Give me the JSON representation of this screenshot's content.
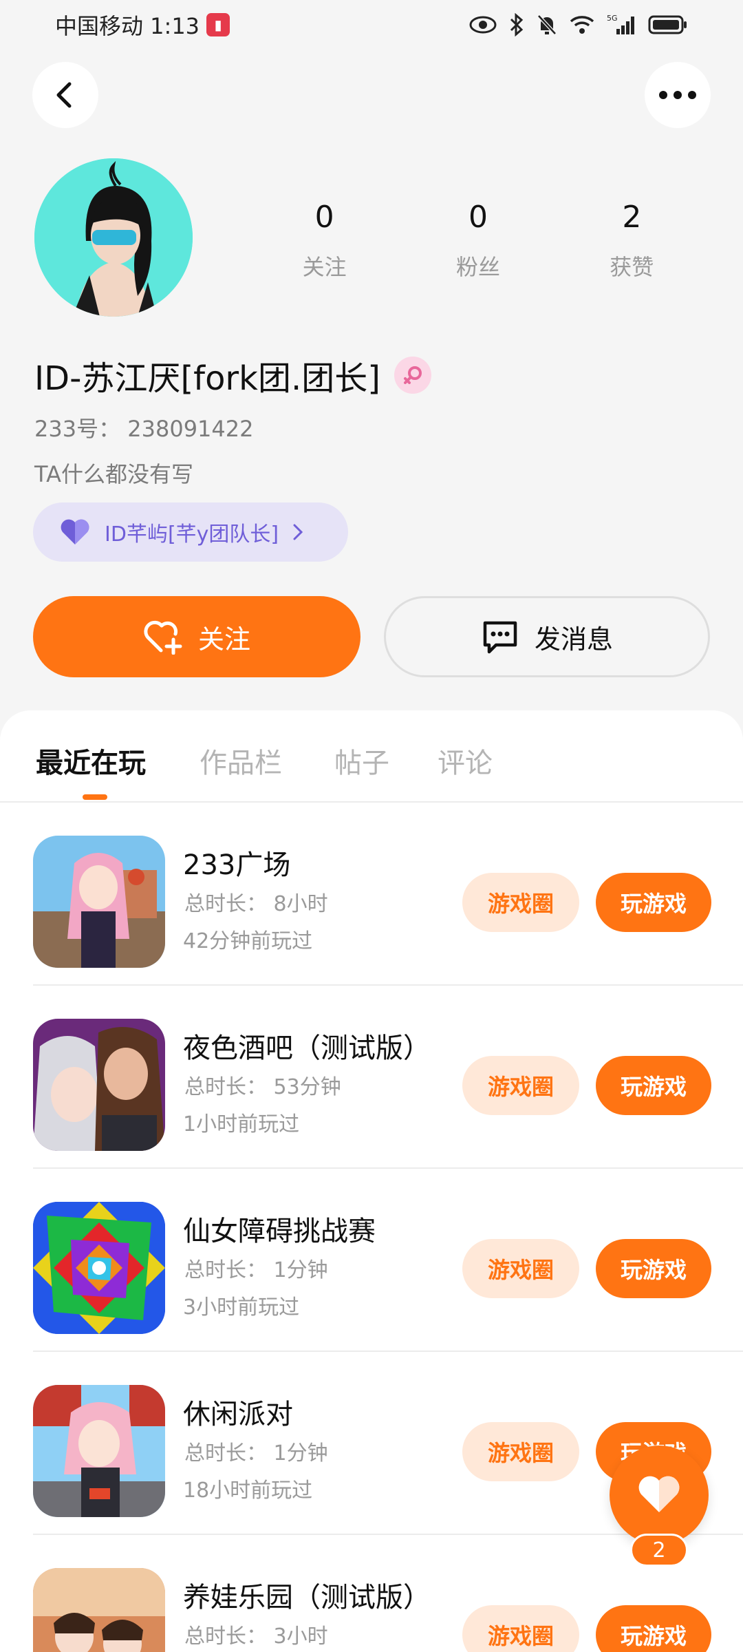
{
  "status_bar": {
    "carrier_time": "中国移动 1:13"
  },
  "profile": {
    "stats": [
      {
        "value": "0",
        "label": "关注"
      },
      {
        "value": "0",
        "label": "粉丝"
      },
      {
        "value": "2",
        "label": "获赞"
      }
    ],
    "name": "ID-苏江厌[fork团.团长]",
    "id_line": "233号： 238091422",
    "bio": "TA什么都没有写",
    "team_chip": "ID芊屿[芊y团队长]"
  },
  "actions": {
    "follow": "关注",
    "message": "发消息"
  },
  "tabs": [
    "最近在玩",
    "作品栏",
    "帖子",
    "评论"
  ],
  "games": [
    {
      "title": "233广场",
      "duration": "总时长： 8小时",
      "last_played": "42分钟前玩过",
      "circle": "游戏圈",
      "play": "玩游戏"
    },
    {
      "title": "夜色酒吧（测试版）",
      "duration": "总时长： 53分钟",
      "last_played": "1小时前玩过",
      "circle": "游戏圈",
      "play": "玩游戏"
    },
    {
      "title": "仙女障碍挑战赛",
      "duration": "总时长： 1分钟",
      "last_played": "3小时前玩过",
      "circle": "游戏圈",
      "play": "玩游戏"
    },
    {
      "title": "休闲派对",
      "duration": "总时长： 1分钟",
      "last_played": "18小时前玩过",
      "circle": "游戏圈",
      "play": "玩游戏"
    },
    {
      "title": "养娃乐园（测试版）",
      "duration": "总时长： 3小时",
      "last_played": "",
      "circle": "游戏圈",
      "play": "玩游戏"
    }
  ],
  "floating_like": {
    "count": "2"
  },
  "icons": {
    "back": "back-arrow-icon",
    "more": "more-dots-icon",
    "gender": "female-icon",
    "team": "heart-icon",
    "follow": "heart-plus-icon",
    "message": "chat-bubble-icon",
    "float": "heart-icon"
  },
  "colors": {
    "accent": "#ff7413",
    "accent_light": "#ffe8d8",
    "team_chip_bg": "#e6e3f7",
    "team_chip_text": "#6f5ed8",
    "gender_badge": "#fbd7e6"
  }
}
